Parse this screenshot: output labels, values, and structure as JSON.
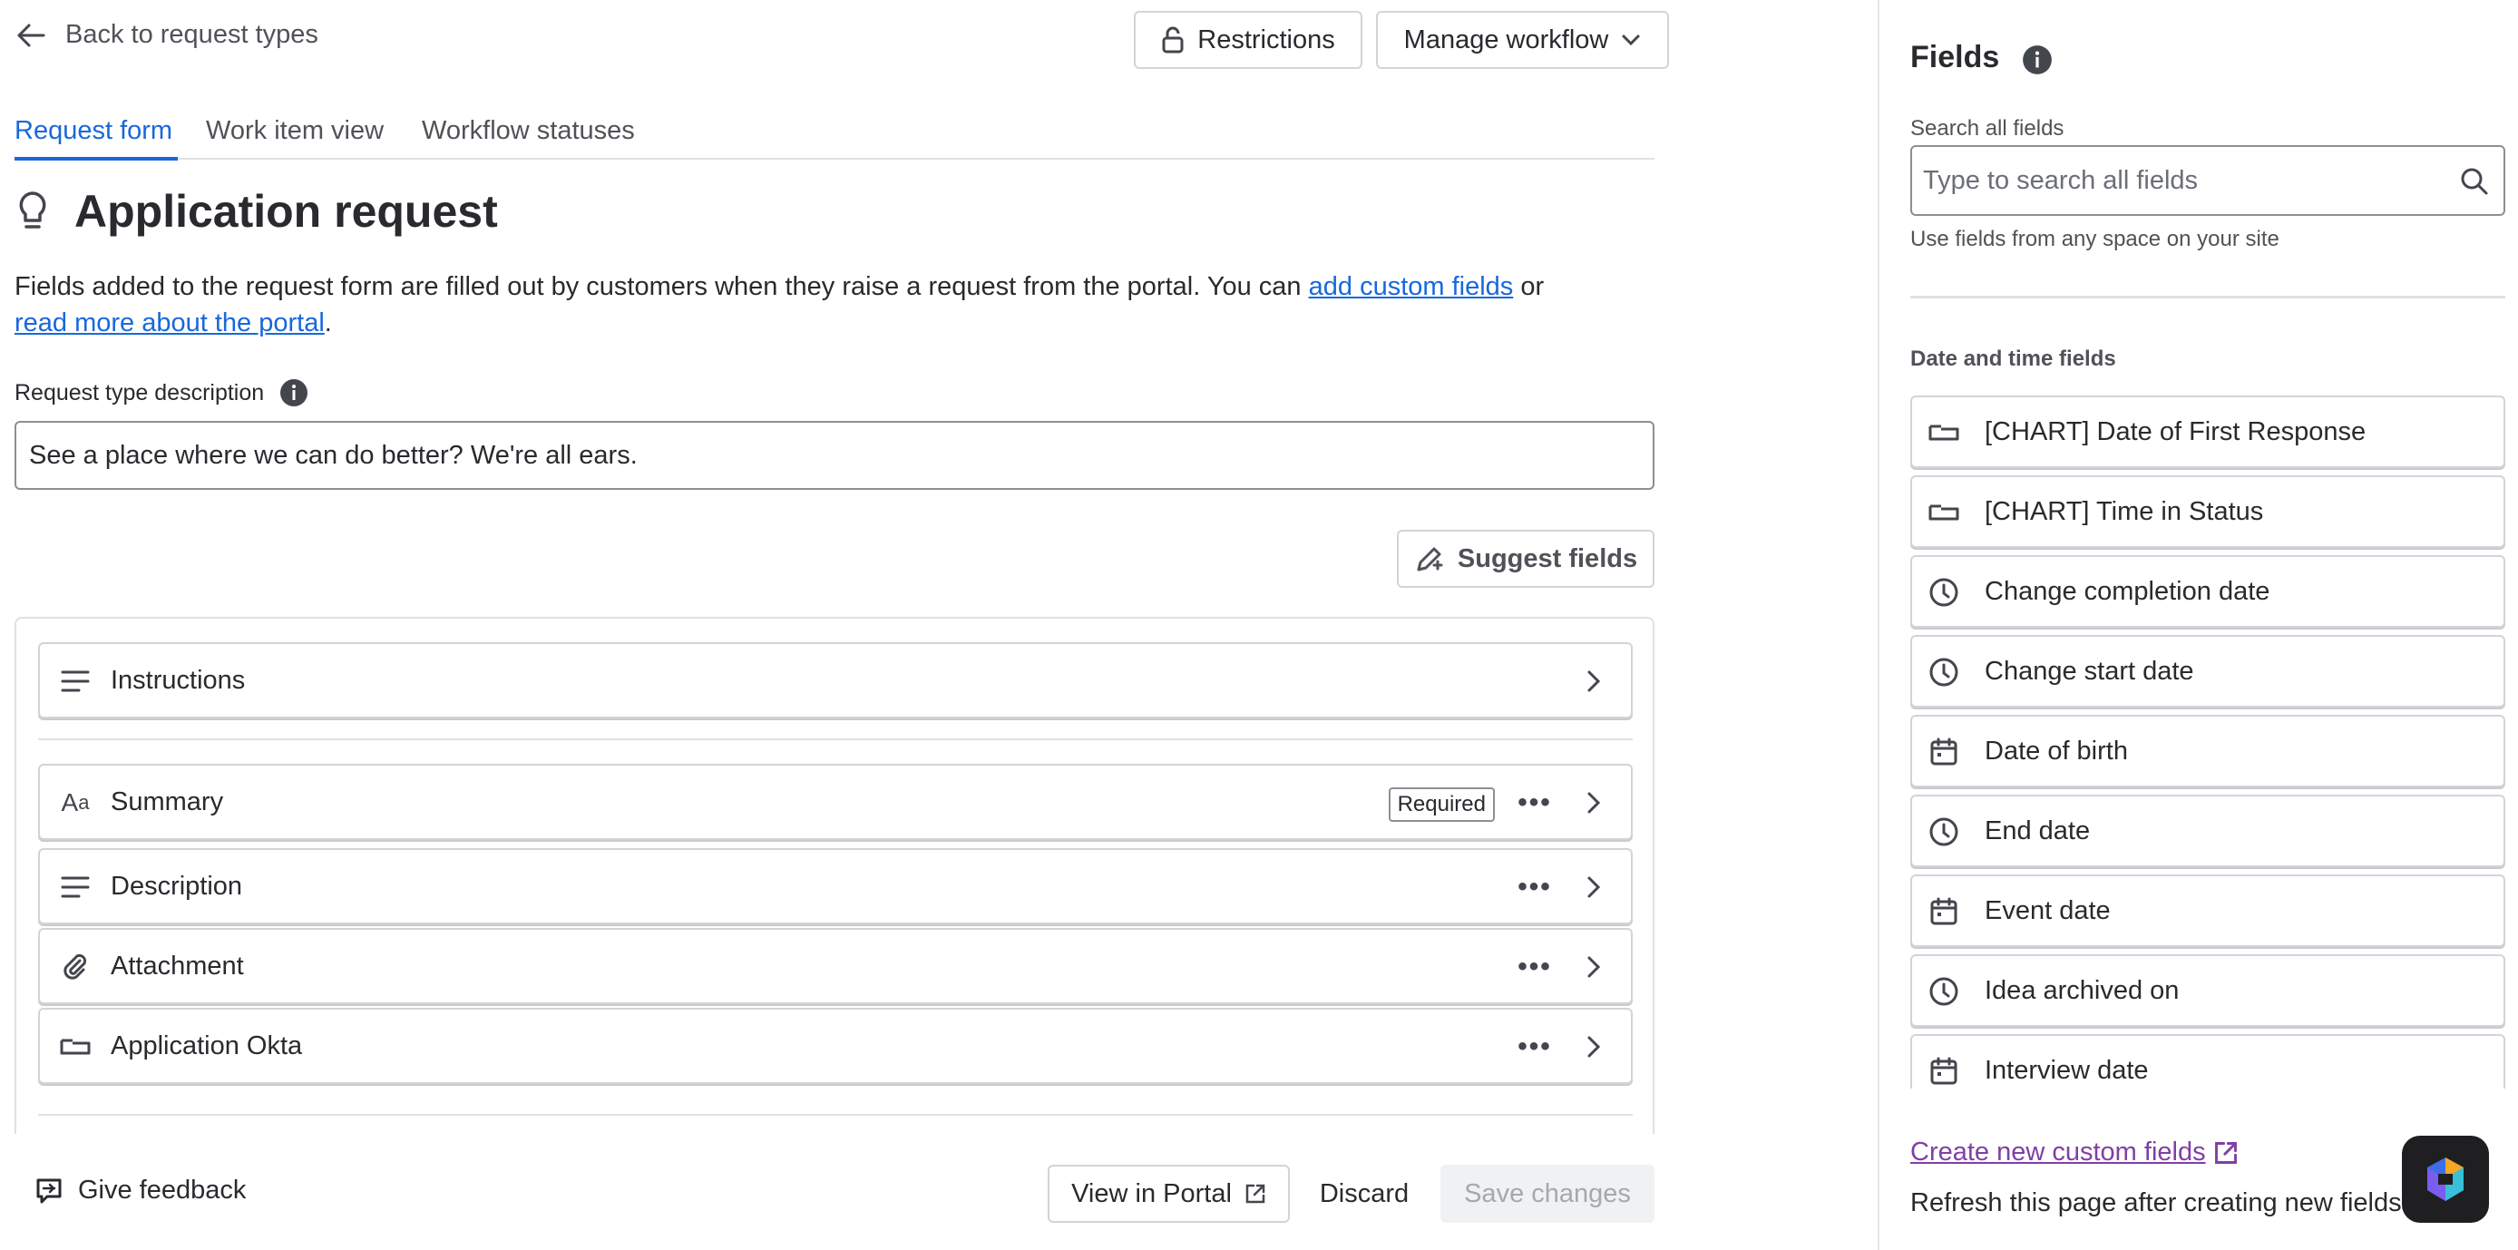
{
  "header": {
    "back_label": "Back to request types",
    "restrictions_label": "Restrictions",
    "manage_workflow_label": "Manage workflow"
  },
  "tabs": [
    {
      "label": "Request form",
      "active": true
    },
    {
      "label": "Work item view",
      "active": false
    },
    {
      "label": "Workflow statuses",
      "active": false
    }
  ],
  "page": {
    "title": "Application request",
    "intro_text_1": "Fields added to the request form are filled out by customers when they raise a request from the portal. You can ",
    "intro_link_1": "add custom fields",
    "intro_text_2": " or",
    "intro_link_2": "read more about the portal",
    "intro_text_3": ".",
    "description_label": "Request type description",
    "description_value": "See a place where we can do better? We're all ears.",
    "suggest_label": "Suggest fields"
  },
  "form_fields": [
    {
      "icon": "text-lines-icon",
      "label": "Instructions"
    },
    {
      "icon": "short-text-icon",
      "label": "Summary",
      "badge": "Required"
    },
    {
      "icon": "text-lines-icon",
      "label": "Description"
    },
    {
      "icon": "paperclip-icon",
      "label": "Attachment"
    },
    {
      "icon": "text-field-icon",
      "label": "Application Okta"
    }
  ],
  "footer": {
    "feedback_label": "Give feedback",
    "view_portal_label": "View in Portal",
    "discard_label": "Discard",
    "save_label": "Save changes"
  },
  "panel": {
    "title": "Fields",
    "search_label": "Search all fields",
    "search_placeholder": "Type to search all fields",
    "search_help": "Use fields from any space on your site",
    "section_title": "Date and time fields",
    "fields": [
      {
        "icon": "text-field-icon",
        "label": "[CHART] Date of First Response"
      },
      {
        "icon": "text-field-icon",
        "label": "[CHART] Time in Status"
      },
      {
        "icon": "clock-icon",
        "label": "Change completion date"
      },
      {
        "icon": "clock-icon",
        "label": "Change start date"
      },
      {
        "icon": "calendar-icon",
        "label": "Date of birth"
      },
      {
        "icon": "clock-icon",
        "label": "End date"
      },
      {
        "icon": "calendar-icon",
        "label": "Event date"
      },
      {
        "icon": "clock-icon",
        "label": "Idea archived on"
      },
      {
        "icon": "calendar-icon",
        "label": "Interview date"
      }
    ],
    "create_link": "Create new custom fields",
    "refresh_note": "Refresh this page after creating new fields"
  },
  "colors": {
    "accent": "#1868db",
    "visited_link": "#803fa5",
    "text": "#292a2e",
    "subtle_text": "#505258",
    "border": "#d3d4d8"
  }
}
